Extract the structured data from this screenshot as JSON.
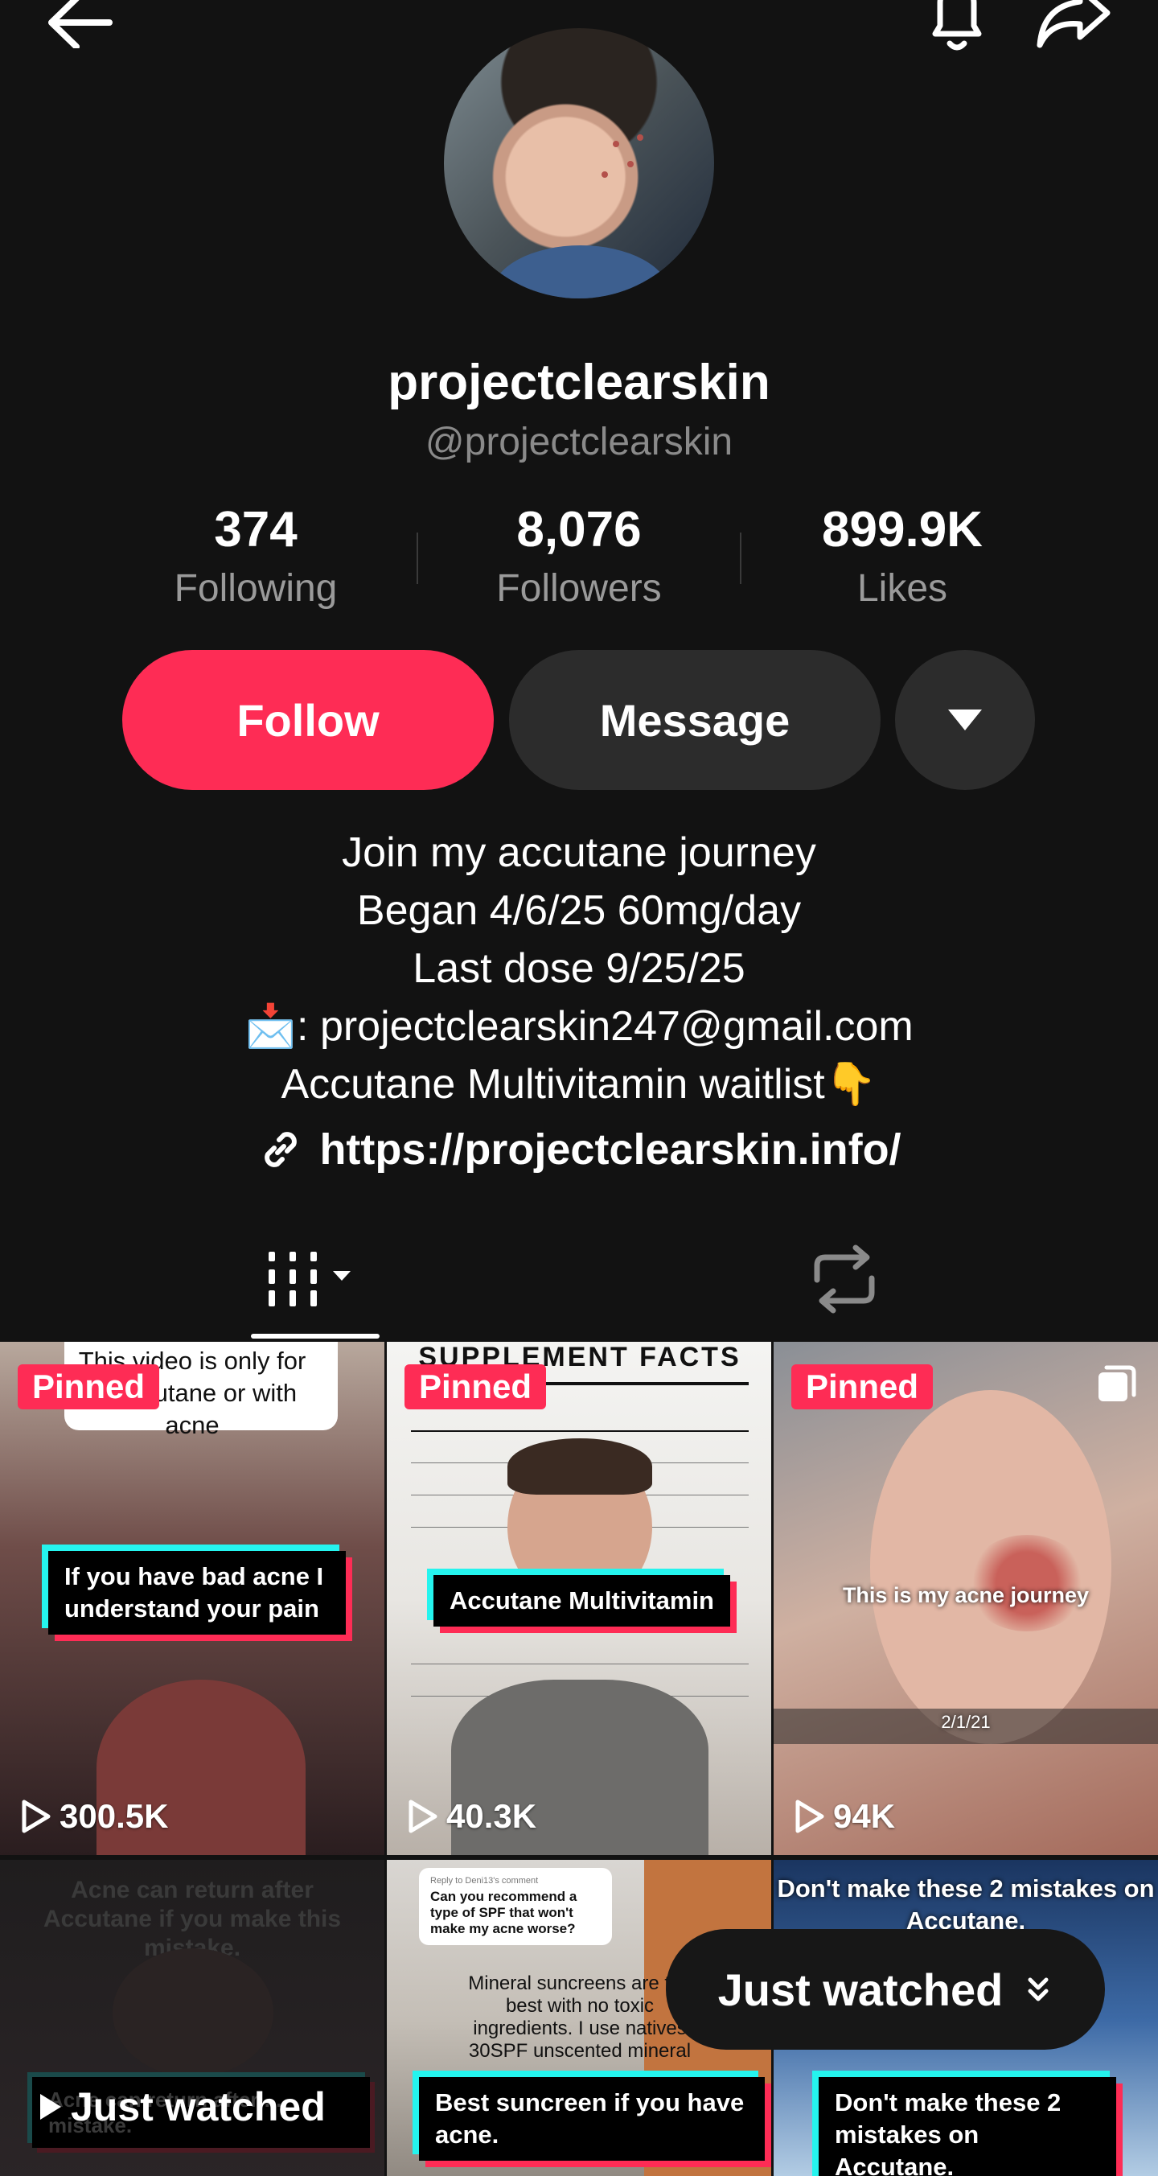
{
  "header": {
    "back_icon": "back-arrow-icon",
    "bell_icon": "bell-icon",
    "share_icon": "share-icon"
  },
  "profile": {
    "display_name": "projectclearskin",
    "handle": "@projectclearskin"
  },
  "stats": [
    {
      "value": "374",
      "label": "Following"
    },
    {
      "value": "8,076",
      "label": "Followers"
    },
    {
      "value": "899.9K",
      "label": "Likes"
    }
  ],
  "actions": {
    "follow_label": "Follow",
    "message_label": "Message",
    "more_icon": "triangle-down-icon"
  },
  "bio": {
    "lines": [
      "Join my accutane journey",
      "Began 4/6/25 60mg/day",
      "Last dose 9/25/25",
      "📩: projectclearskin247@gmail.com",
      "Accutane Multivitamin waitlist👇"
    ],
    "link": "https://projectclearskin.info/"
  },
  "tabs": {
    "videos_icon": "grid-icon",
    "repost_icon": "repost-icon"
  },
  "colors": {
    "accent": "#fe2c55",
    "background": "#121212",
    "secondary_button": "#2c2c2c"
  },
  "videos": [
    {
      "pinned": "Pinned",
      "views": "300.5K",
      "top_caption": "This video is only for ... accutane or with acne",
      "caption": "If you have bad acne I understand your pain"
    },
    {
      "pinned": "Pinned",
      "views": "40.3K",
      "top_caption": "SUPPLEMENT FACTS",
      "caption": "Accutane Multivitamin"
    },
    {
      "pinned": "Pinned",
      "views": "94K",
      "caption": "This is my acne journey",
      "date": "2/1/21"
    },
    {
      "top_caption": "Acne can return after Accutane if you make this mistake.",
      "caption": "Acne can return after ... mistake."
    },
    {
      "reply_label": "Reply to Deni13's comment",
      "reply_text": "Can you recommend a type of SPF that won't make my acne worse?",
      "mid_text": "Mineral suncreens are the best with no toxic ingredients. I use natives 30SPF unscented mineral",
      "caption": "Best suncreen if you have acne."
    },
    {
      "top_caption": "Don't make these 2 mistakes on Accutane.",
      "caption": "Don't make these 2 mistakes on Accutane."
    }
  ],
  "just_watched": {
    "pill_label": "Just watched",
    "thumb_label": "Just watched"
  }
}
